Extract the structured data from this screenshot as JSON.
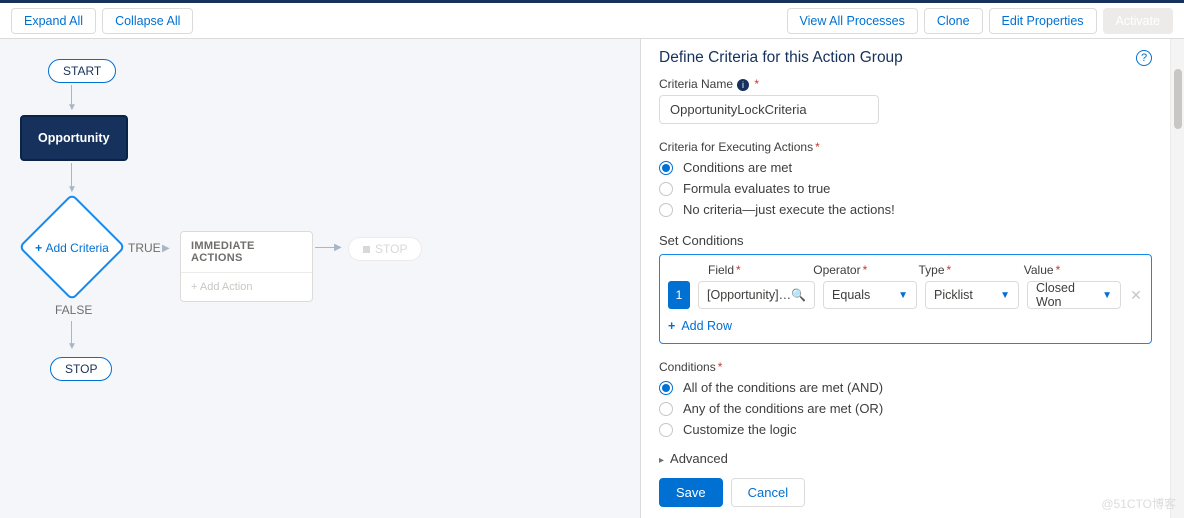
{
  "toolbar": {
    "expand_all": "Expand All",
    "collapse_all": "Collapse All",
    "view_all": "View All Processes",
    "clone": "Clone",
    "edit_props": "Edit Properties",
    "activate": "Activate"
  },
  "canvas": {
    "start": "START",
    "object_node": "Opportunity",
    "add_criteria": "Add Criteria",
    "true_label": "TRUE",
    "false_label": "FALSE",
    "immediate_header": "IMMEDIATE ACTIONS",
    "add_action": "+ Add Action",
    "stop_right": "STOP",
    "stop_bottom": "STOP"
  },
  "panel": {
    "title": "Define Criteria for this Action Group",
    "criteria_name_label": "Criteria Name",
    "criteria_name_value": "OpportunityLockCriteria",
    "exec_label": "Criteria for Executing Actions",
    "exec_options": {
      "met": "Conditions are met",
      "formula": "Formula evaluates to true",
      "none": "No criteria—just execute the actions!"
    },
    "exec_selected": "met",
    "set_conditions": "Set Conditions",
    "headers": {
      "field": "Field",
      "operator": "Operator",
      "type": "Type",
      "value": "Value"
    },
    "row": {
      "num": "1",
      "field": "[Opportunity]…",
      "operator": "Equals",
      "type": "Picklist",
      "value": "Closed Won"
    },
    "add_row": "Add Row",
    "conditions_label": "Conditions",
    "logic_options": {
      "and": "All of the conditions are met (AND)",
      "or": "Any of the conditions are met (OR)",
      "custom": "Customize the logic"
    },
    "logic_selected": "and",
    "advanced": "Advanced",
    "save": "Save",
    "cancel": "Cancel"
  },
  "watermark": "@51CTO博客"
}
